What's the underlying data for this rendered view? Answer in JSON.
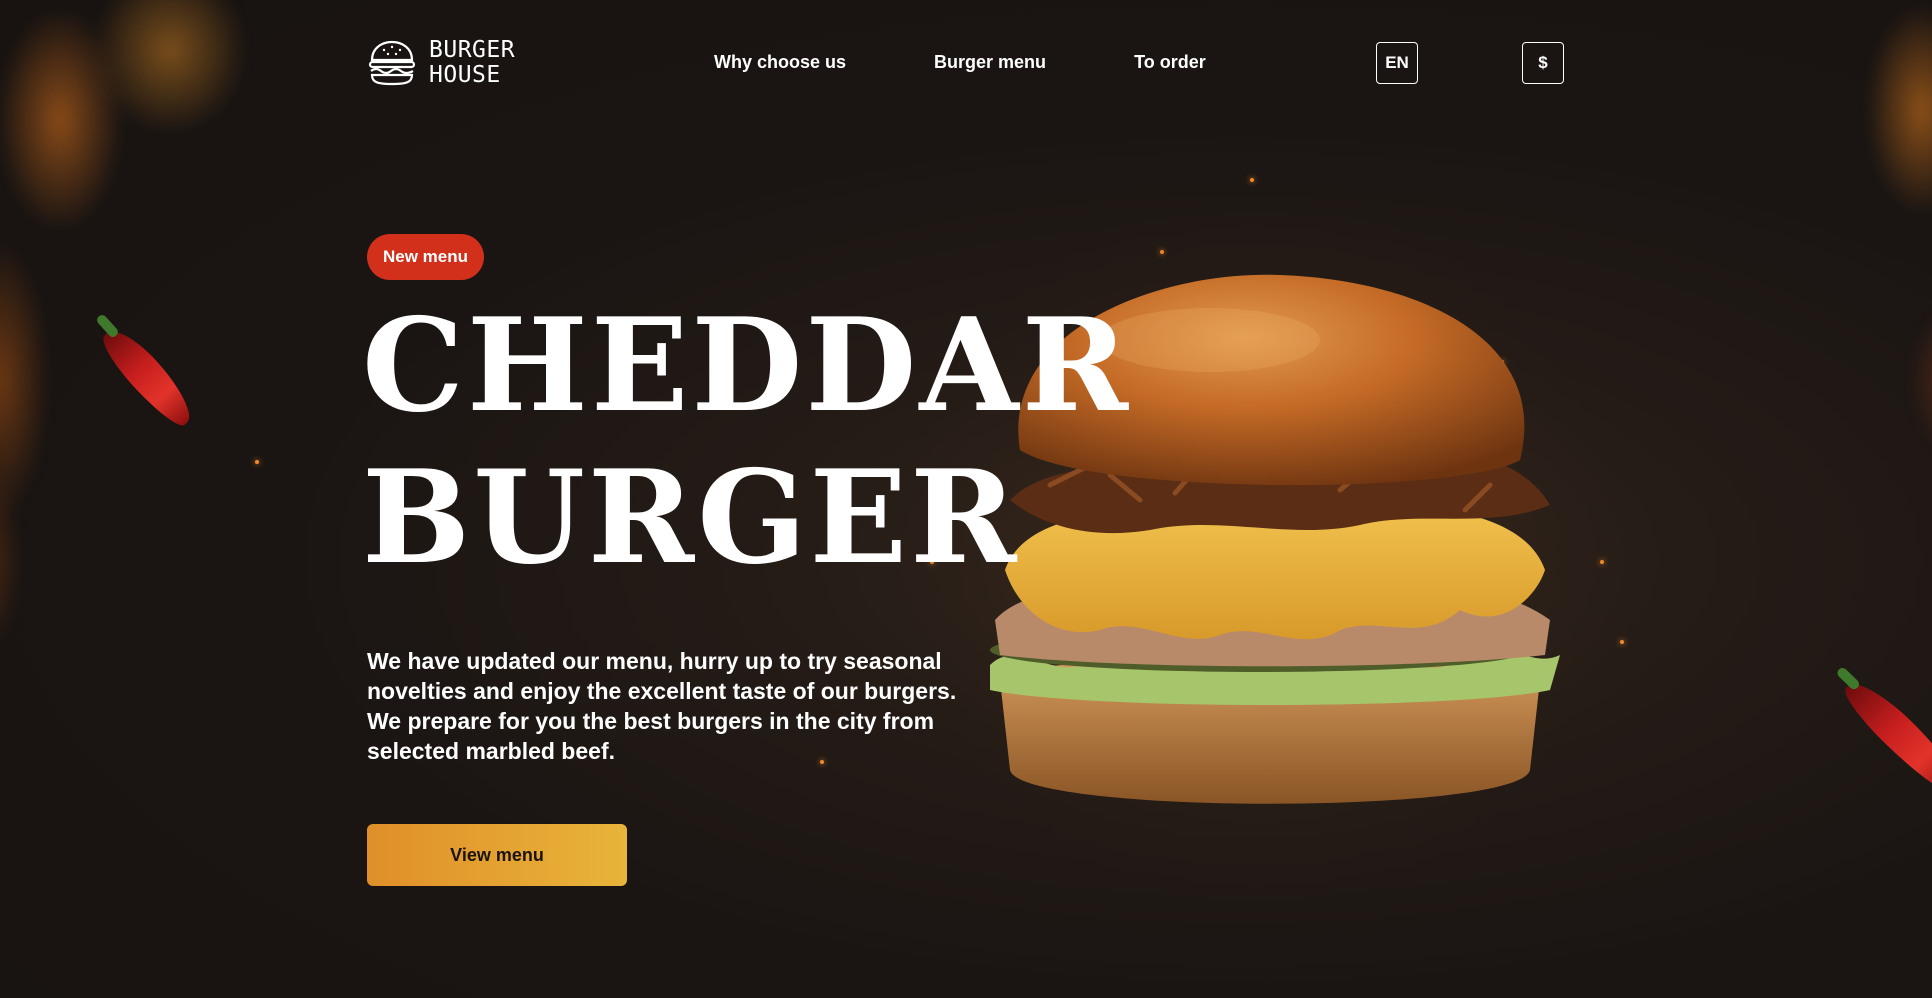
{
  "brand": {
    "line1": "BURGER",
    "line2": "HOUSE",
    "icon": "burger-icon"
  },
  "nav": {
    "items": [
      {
        "label": "Why choose us"
      },
      {
        "label": "Burger menu"
      },
      {
        "label": "To order"
      }
    ]
  },
  "header": {
    "language": "EN",
    "currency": "$"
  },
  "hero": {
    "badge": "New menu",
    "title_line1": "CHEDDAR",
    "title_line2": "BURGER",
    "description": "We have updated our menu, hurry up to try seasonal novelties and enjoy the excellent taste of our burgers. We prepare for you the best burgers in the city from selected marbled beef.",
    "cta_label": "View menu"
  },
  "colors": {
    "background": "#1a1513",
    "badge": "#d3301b",
    "cta_start": "#e08f28",
    "cta_end": "#e8b43a",
    "text": "#ffffff"
  }
}
